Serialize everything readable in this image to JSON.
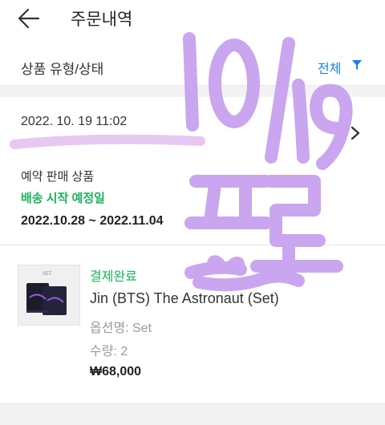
{
  "header": {
    "title": "주문내역",
    "back_icon": "arrow-left-icon"
  },
  "filter": {
    "label": "상품 유형/상태",
    "value": "전체",
    "icon": "filter-funnel-icon",
    "accent_color": "#1a7ee8"
  },
  "order": {
    "date": "2022. 10. 19 11:02",
    "sale_type": "예약 판매 상품",
    "ship_label": "배송 시작 예정일",
    "ship_range": "2022.10.28 ~ 2022.11.04",
    "status_color": "#19b35e",
    "chevron_icon": "chevron-right-icon"
  },
  "item": {
    "thumb_label": "SET",
    "status": "결제완료",
    "name": "Jin (BTS) The Astronaut (Set)",
    "option": "옵션명: Set",
    "quantity": "수량: 2",
    "price": "₩68,000"
  },
  "handwritten_overlay": {
    "lines": [
      "10/19",
      "프로"
    ],
    "color": "#c8a8f0"
  }
}
